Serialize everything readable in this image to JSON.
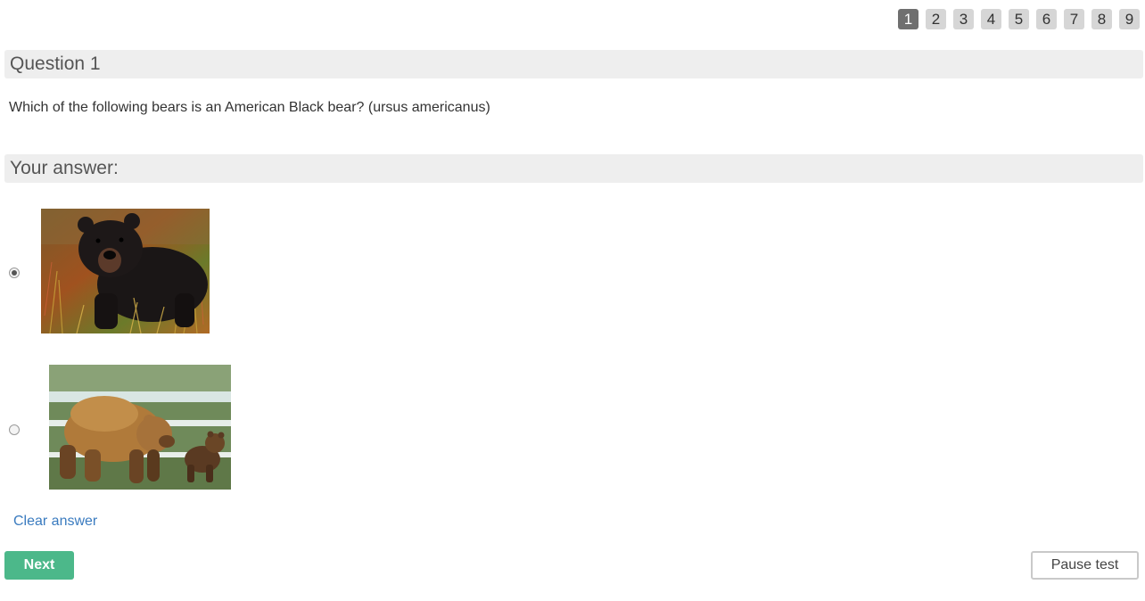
{
  "navigation": {
    "question_numbers": [
      "1",
      "2",
      "3",
      "4",
      "5",
      "6",
      "7",
      "8",
      "9"
    ],
    "active": "1"
  },
  "question": {
    "header": "Question 1",
    "text": "Which of the following bears is an American Black bear? (ursus americanus)"
  },
  "answer": {
    "header": "Your answer:",
    "options": [
      {
        "image": "black-bear-photo",
        "selected": true
      },
      {
        "image": "brown-bear-with-cub-photo",
        "selected": false
      }
    ],
    "clear_label": "Clear answer"
  },
  "buttons": {
    "next": "Next",
    "pause": "Pause test"
  },
  "colors": {
    "active_nav": "#6f6f6f",
    "inactive_nav": "#d6d6d6",
    "next_button": "#4cb88a",
    "link": "#3a7bbf"
  }
}
